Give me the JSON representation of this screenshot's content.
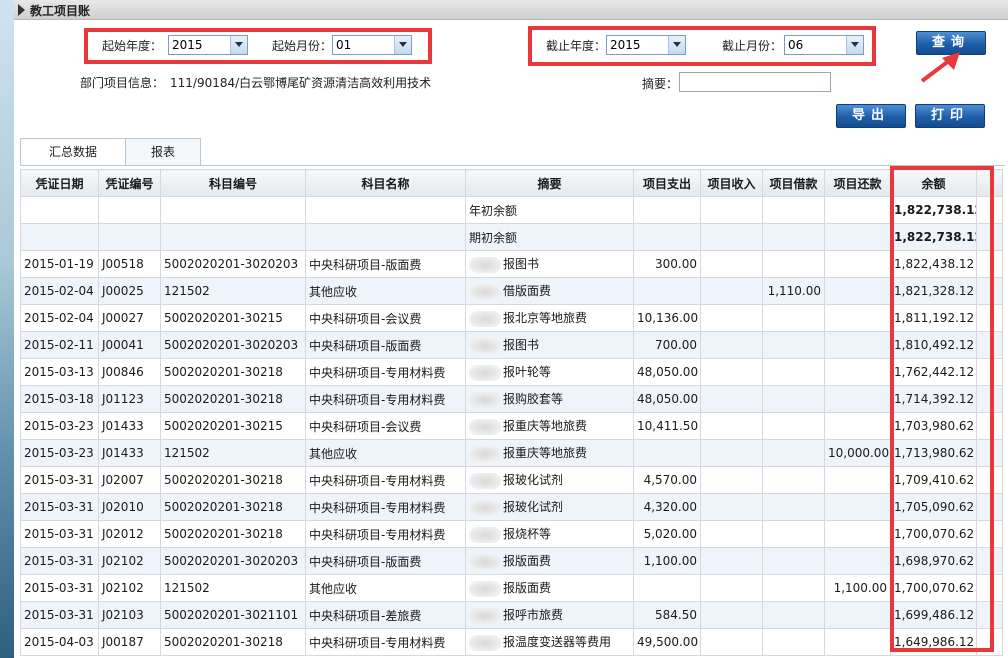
{
  "title": "教工项目账",
  "filters": {
    "start_year_label": "起始年度：",
    "start_year": "2015",
    "start_month_label": "起始月份：",
    "start_month": "01",
    "end_year_label": "截止年度：",
    "end_year": "2015",
    "end_month_label": "截止月份：",
    "end_month": "06",
    "dept_label": "部门项目信息：",
    "dept_value": "111/90184/白云鄂博尾矿资源清洁高效利用技术",
    "summary_label": "摘要：",
    "summary_value": ""
  },
  "buttons": {
    "query": "查询",
    "export": "导出",
    "print": "打印"
  },
  "tabs": [
    "汇总数据",
    "报表"
  ],
  "columns": [
    "凭证日期",
    "凭证编号",
    "科目编号",
    "科目名称",
    "摘要",
    "项目支出",
    "项目收入",
    "项目借款",
    "项目还款",
    "余额"
  ],
  "rows": [
    {
      "date": "",
      "voucher": "",
      "code": "",
      "name": "",
      "summary": "年初余额",
      "expense": "",
      "income": "",
      "borrow": "",
      "repay": "",
      "balance": "1,822,738.12"
    },
    {
      "date": "",
      "voucher": "",
      "code": "",
      "name": "",
      "summary": "期初余额",
      "expense": "",
      "income": "",
      "borrow": "",
      "repay": "",
      "balance": "1,822,738.12"
    },
    {
      "date": "2015-01-19",
      "voucher": "J00518",
      "code": "5002020201-3020203",
      "name": "中央科研项目-版面费",
      "summary": "报图书",
      "expense": "300.00",
      "income": "",
      "borrow": "",
      "repay": "",
      "balance": "1,822,438.12"
    },
    {
      "date": "2015-02-04",
      "voucher": "J00025",
      "code": "121502",
      "name": "其他应收",
      "summary": "借版面费",
      "expense": "",
      "income": "",
      "borrow": "1,110.00",
      "repay": "",
      "balance": "1,821,328.12"
    },
    {
      "date": "2015-02-04",
      "voucher": "J00027",
      "code": "5002020201-30215",
      "name": "中央科研项目-会议费",
      "summary": "报北京等地旅费",
      "expense": "10,136.00",
      "income": "",
      "borrow": "",
      "repay": "",
      "balance": "1,811,192.12"
    },
    {
      "date": "2015-02-11",
      "voucher": "J00041",
      "code": "5002020201-3020203",
      "name": "中央科研项目-版面费",
      "summary": "报图书",
      "expense": "700.00",
      "income": "",
      "borrow": "",
      "repay": "",
      "balance": "1,810,492.12"
    },
    {
      "date": "2015-03-13",
      "voucher": "J00846",
      "code": "5002020201-30218",
      "name": "中央科研项目-专用材料费",
      "summary": "报叶轮等",
      "expense": "48,050.00",
      "income": "",
      "borrow": "",
      "repay": "",
      "balance": "1,762,442.12"
    },
    {
      "date": "2015-03-18",
      "voucher": "J01123",
      "code": "5002020201-30218",
      "name": "中央科研项目-专用材料费",
      "summary": "报购胶套等",
      "expense": "48,050.00",
      "income": "",
      "borrow": "",
      "repay": "",
      "balance": "1,714,392.12"
    },
    {
      "date": "2015-03-23",
      "voucher": "J01433",
      "code": "5002020201-30215",
      "name": "中央科研项目-会议费",
      "summary": "报重庆等地旅费",
      "expense": "10,411.50",
      "income": "",
      "borrow": "",
      "repay": "",
      "balance": "1,703,980.62"
    },
    {
      "date": "2015-03-23",
      "voucher": "J01433",
      "code": "121502",
      "name": "其他应收",
      "summary": "报重庆等地旅费",
      "expense": "",
      "income": "",
      "borrow": "",
      "repay": "10,000.00",
      "balance": "1,713,980.62"
    },
    {
      "date": "2015-03-31",
      "voucher": "J02007",
      "code": "5002020201-30218",
      "name": "中央科研项目-专用材料费",
      "summary": "报玻化试剂",
      "expense": "4,570.00",
      "income": "",
      "borrow": "",
      "repay": "",
      "balance": "1,709,410.62"
    },
    {
      "date": "2015-03-31",
      "voucher": "J02010",
      "code": "5002020201-30218",
      "name": "中央科研项目-专用材料费",
      "summary": "报玻化试剂",
      "expense": "4,320.00",
      "income": "",
      "borrow": "",
      "repay": "",
      "balance": "1,705,090.62"
    },
    {
      "date": "2015-03-31",
      "voucher": "J02012",
      "code": "5002020201-30218",
      "name": "中央科研项目-专用材料费",
      "summary": "报烧杯等",
      "expense": "5,020.00",
      "income": "",
      "borrow": "",
      "repay": "",
      "balance": "1,700,070.62"
    },
    {
      "date": "2015-03-31",
      "voucher": "J02102",
      "code": "5002020201-3020203",
      "name": "中央科研项目-版面费",
      "summary": "报版面费",
      "expense": "1,100.00",
      "income": "",
      "borrow": "",
      "repay": "",
      "balance": "1,698,970.62"
    },
    {
      "date": "2015-03-31",
      "voucher": "J02102",
      "code": "121502",
      "name": "其他应收",
      "summary": "报版面费",
      "expense": "",
      "income": "",
      "borrow": "",
      "repay": "1,100.00",
      "balance": "1,700,070.62"
    },
    {
      "date": "2015-03-31",
      "voucher": "J02103",
      "code": "5002020201-3021101",
      "name": "中央科研项目-差旅费",
      "summary": "报呼市旅费",
      "expense": "584.50",
      "income": "",
      "borrow": "",
      "repay": "",
      "balance": "1,699,486.12"
    },
    {
      "date": "2015-04-03",
      "voucher": "J00187",
      "code": "5002020201-30218",
      "name": "中央科研项目-专用材料费",
      "summary": "报温度变送器等费用",
      "expense": "49,500.00",
      "income": "",
      "borrow": "",
      "repay": "",
      "balance": "1,649,986.12"
    }
  ],
  "colors": {
    "highlight": "#e8383d",
    "button": "#1d5eaa"
  }
}
